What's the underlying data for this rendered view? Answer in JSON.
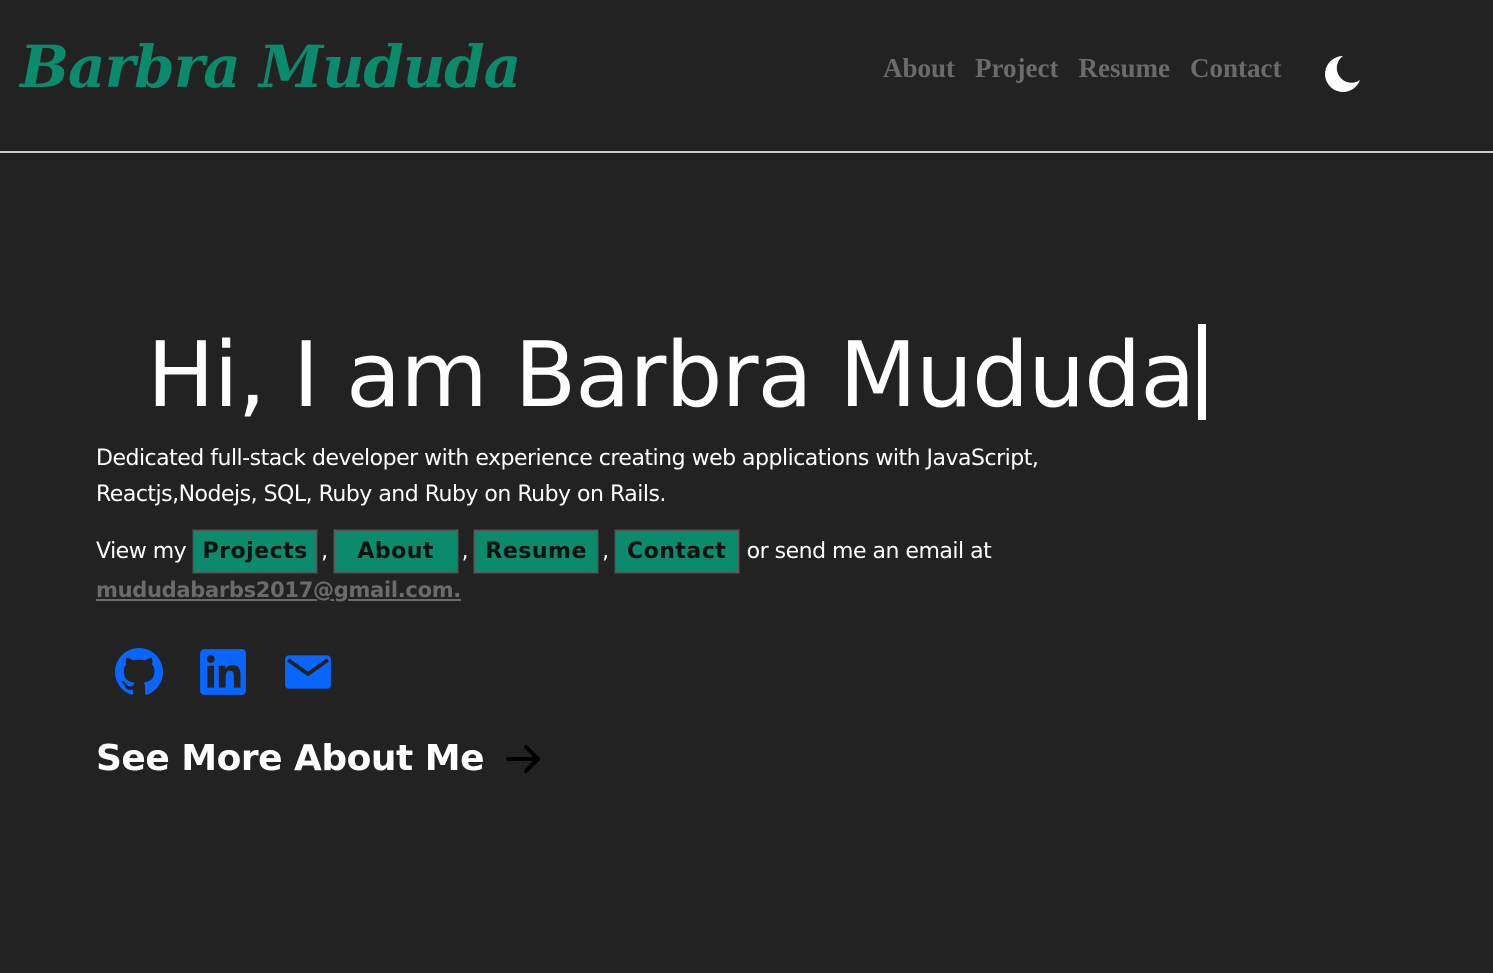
{
  "header": {
    "logo": "Barbra Mududa",
    "nav": [
      "About",
      "Project",
      "Resume",
      "Contact"
    ],
    "theme_toggle_icon": "moon-icon"
  },
  "hero": {
    "title": "Hi, I am Barbra Mududa",
    "description": "Dedicated full-stack developer with experience creating web applications with JavaScript, Reactjs,Nodejs, SQL, Ruby and Ruby on Ruby on Rails.",
    "view_prefix": "View my",
    "buttons": [
      "Projects",
      "About",
      "Resume",
      "Contact"
    ],
    "separator": ",",
    "email_prefix": "or send me an email at",
    "email": "mududabarbs2017@gmail.com."
  },
  "social": [
    {
      "icon": "github-icon"
    },
    {
      "icon": "linkedin-icon"
    },
    {
      "icon": "mail-icon"
    }
  ],
  "see_more": {
    "label": "See More About Me",
    "icon": "arrow-right-icon"
  },
  "colors": {
    "background": "#222222",
    "accent": "#0b8a6c",
    "nav_text": "#6b6b6b",
    "social_icons": "#0866ff"
  }
}
